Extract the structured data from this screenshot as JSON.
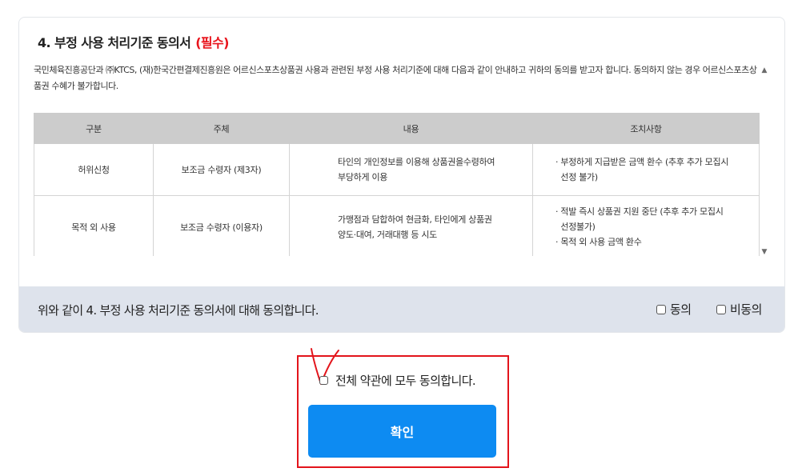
{
  "section": {
    "title": "4. 부정 사용 처리기준 동의서",
    "required_label": "(필수)",
    "intro": "국민체육진흥공단과 ㈜KTCS, (재)한국간편결제진흥원은 어르신스포츠상품권 사용과 관련된 부정 사용 처리기준에 대해 다음과 같이 안내하고 귀하의 동의를 받고자 합니다. 동의하지 않는 경우 어르신스포츠상품권 수혜가 불가합니다."
  },
  "table": {
    "headers": [
      "구분",
      "주체",
      "내용",
      "조치사항"
    ],
    "rows": [
      {
        "category": "허위신청",
        "subject": "보조금 수령자 (제3자)",
        "content": [
          "타인의 개인정보를 이용해 상품권을수령하여",
          "부당하게 이용"
        ],
        "actions": [
          "· 부정하게 지급받은 금액 환수 (추후 추가 모집시",
          "  선정 불가)"
        ]
      },
      {
        "category": "목적 외 사용",
        "subject": "보조금 수령자 (이용자)",
        "content": [
          "가맹점과 담합하여 현금화, 타인에게 상품권",
          "양도·대여, 거래대행 등 시도"
        ],
        "actions": [
          "· 적발 즉시 상품권 지원 중단 (추후 추가 모집시",
          "  선정불가)",
          "· 목적 외 사용 금액 환수"
        ]
      }
    ]
  },
  "agreement": {
    "statement": "위와 같이 4. 부정 사용 처리기준 동의서에 대해 동의합니다.",
    "agree_label": "동의",
    "disagree_label": "비동의"
  },
  "footer": {
    "agree_all_label": "전체 약관에 모두 동의합니다.",
    "confirm_label": "확인"
  },
  "colors": {
    "required": "#e8141c",
    "confirm_button": "#0d8bf2",
    "highlight_box": "#e3141b",
    "agree_bar": "#dee3ec",
    "table_header": "#cccccc"
  },
  "icons": {
    "scroll_up": "▲",
    "scroll_down": "▼"
  }
}
